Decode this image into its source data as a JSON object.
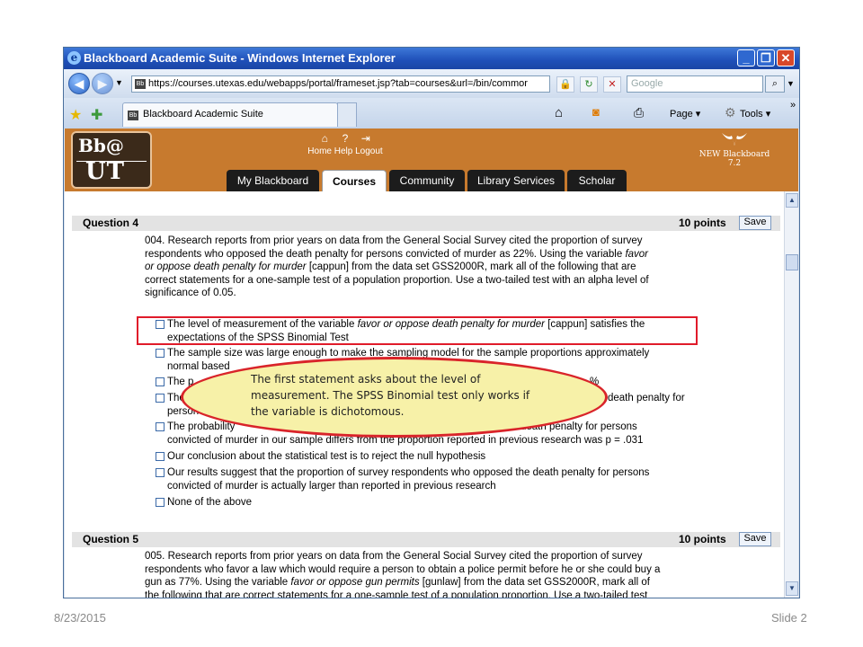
{
  "browser": {
    "title": "Blackboard Academic Suite - Windows Internet Explorer",
    "url": "https://courses.utexas.edu/webapps/portal/frameset.jsp?tab=courses&url=/bin/commor",
    "search_placeholder": "Google",
    "tab_label": "Blackboard Academic Suite",
    "commands": {
      "page": "Page ▾",
      "tools": "Tools ▾",
      "more": "»"
    }
  },
  "blackboard": {
    "logo_line1": "Bb@",
    "logo_line2": "UT",
    "top_nav": [
      "Home",
      "Help",
      "Logout"
    ],
    "brand_line1": "NEW Blackboard",
    "brand_line2": "7.2",
    "tabs": [
      "My Blackboard",
      "Courses",
      "Community",
      "Library Services",
      "Scholar"
    ],
    "active_tab": "Courses"
  },
  "question4": {
    "title": "Question 4",
    "points": "10 points",
    "save_label": "Save",
    "text_lines": [
      "004. Research reports from prior years on data from the General Social Survey cited the proportion of survey",
      "respondents who opposed the death penalty for persons convicted of murder as 22%. Using the variable favor",
      "or oppose death penalty for murder [cappun] from the data set GSS2000R, mark all of the following that are",
      "correct statements for a one-sample test of a population proportion. Use a two-tailed test with an alpha level of",
      "significance of 0.05."
    ],
    "options": [
      [
        "The level of measurement of the variable favor or oppose death penalty for murder [cappun] satisfies the",
        "expectations of the SPSS Binomial Test"
      ],
      [
        "The sample size was large enough to make the sampling model for the sample proportions approximately",
        "normal based"
      ],
      [
        "The p",
        "%"
      ],
      [
        "The",
        "death penalty for",
        "person"
      ],
      [
        "The probability",
        "death penalty for persons",
        "convicted of murder in our sample differs from the proportion reported in previous research was p = .031"
      ],
      [
        "Our conclusion about the statistical test is to reject the null hypothesis"
      ],
      [
        "Our results suggest that the proportion of survey respondents who opposed the death penalty for persons",
        "convicted of murder is actually larger than reported in previous research"
      ],
      [
        "None of the above"
      ]
    ]
  },
  "question5": {
    "title": "Question 5",
    "points": "10 points",
    "save_label": "Save",
    "text_lines": [
      "005. Research reports from prior years on data from the General Social Survey cited the proportion of survey",
      "respondents who favor a law which would require a person to obtain a police permit before he or she could buy a",
      "gun as 77%. Using the variable favor or oppose gun permits [gunlaw] from the data set GSS2000R, mark all of",
      "the following that are correct statements for a one-sample test of a population proportion. Use a two-tailed test"
    ]
  },
  "callout": {
    "text": "The first statement asks about the level of measurement. The SPSS Binomial test only works if the variable is dichotomous."
  },
  "slide": {
    "date": "8/23/2015",
    "number": "Slide 2"
  },
  "colors": {
    "bb_header": "#c77a2e",
    "highlight": "#e01b2a",
    "callout_fill": "#f7f1a8"
  }
}
